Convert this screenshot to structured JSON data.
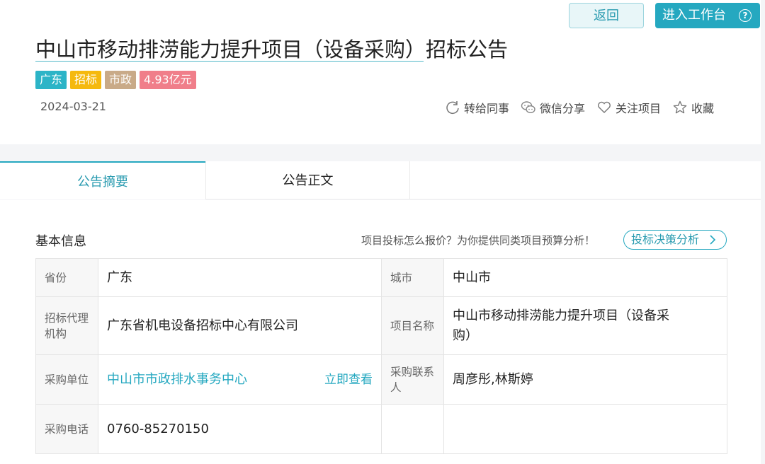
{
  "header": {
    "back_label": "返回",
    "workbench_label": "进入工作台",
    "help_icon_glyph": "?",
    "title": "中山市移动排涝能力提升项目（设备采购）招标公告",
    "tags": [
      {
        "label": "广东",
        "color": "#2cb4c7"
      },
      {
        "label": "招标",
        "color": "#f5b90f"
      },
      {
        "label": "市政",
        "color": "#c9aa88"
      },
      {
        "label": "4.93亿元",
        "color": "#f07e8a"
      }
    ],
    "date": "2024-03-21",
    "actions": [
      {
        "label": "转给同事",
        "icon": "forward-icon"
      },
      {
        "label": "微信分享",
        "icon": "wechat-icon"
      },
      {
        "label": "关注项目",
        "icon": "heart-icon"
      },
      {
        "label": "收藏",
        "icon": "star-icon"
      }
    ]
  },
  "tabs": [
    {
      "label": "公告摘要",
      "active": true
    },
    {
      "label": "公告正文",
      "active": false
    }
  ],
  "basic_info": {
    "section_title": "基本信息",
    "hint": "项目投标怎么报价？为你提供同类项目预算分析！",
    "analysis_label": "投标决策分析",
    "rows": [
      {
        "l1": "省份",
        "v1": "广东",
        "l2": "城市",
        "v2": "中山市"
      },
      {
        "l1": "招标代理机构",
        "v1": "广东省机电设备招标中心有限公司",
        "l2": "项目名称",
        "v2": "中山市移动排涝能力提升项目（设备采购）"
      },
      {
        "l1": "采购单位",
        "v1": "中山市市政排水事务中心",
        "v1_action": "立即查看",
        "l2": "采购联系人",
        "v2": "周彦彤,林斯婷"
      },
      {
        "l1": "采购电话",
        "v1": "0760-85270150",
        "l2": "",
        "v2": ""
      }
    ]
  },
  "colors": {
    "accent": "#25a8c0",
    "link": "#25a8c0"
  }
}
